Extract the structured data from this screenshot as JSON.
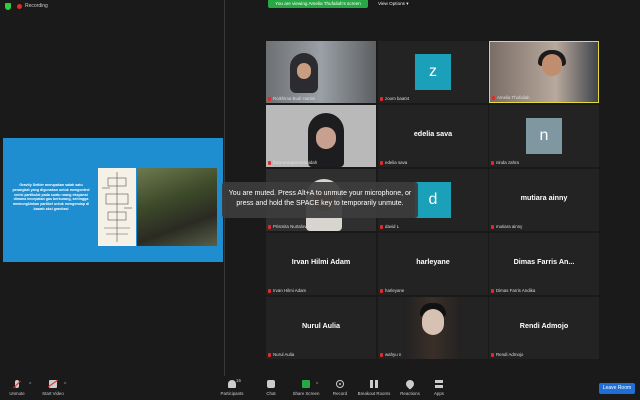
{
  "topbar": {
    "recording_label": "Recording",
    "viewing_banner": "You are viewing Amelia Thufailah's screen",
    "view_options_label": "View Options ▾"
  },
  "slide": {
    "body_text": "Gravity Settler merupakan salah satu perangkat yang digunakan untuk mengontrol emisi partikulat pada suatu ruang ekspansi dimana kecepatan gas berkurang, sehingga memungkinkan partikel untuk mengendap di bawah aksi gravitasi"
  },
  "gallery": {
    "tiles": [
      {
        "name": "Roikhima Budi Hartini",
        "display": ""
      },
      {
        "name": "zoom baa04",
        "display": "z",
        "avatar_color": "#1aa0b8"
      },
      {
        "name": "Amelia Thufailah",
        "display": ""
      },
      {
        "name": "fazurunnajmussaqidah",
        "display": ""
      },
      {
        "name": "edelia sava",
        "display": "edelia sava"
      },
      {
        "name": "ninda zahra",
        "display": "n",
        "avatar_color": "#7f97a1"
      },
      {
        "name": "Prismita Nurtalovesti",
        "display": ""
      },
      {
        "name": "david L",
        "display": "d",
        "avatar_color": "#1aa0b8"
      },
      {
        "name": "mutiara ainny",
        "display": "mutiara ainny"
      },
      {
        "name": "Irvan Hilmi Adam",
        "display": "Irvan Hilmi Adam"
      },
      {
        "name": "harleyane",
        "display": "harleyane"
      },
      {
        "name": "Dimas Farris Andika",
        "display": "Dimas Farris An..."
      },
      {
        "name": "Nurul Aulia",
        "display": "Nurul Aulia"
      },
      {
        "name": "wahyu n",
        "display": ""
      },
      {
        "name": "Rendi Admojo",
        "display": "Rendi Admojo"
      }
    ]
  },
  "toast": {
    "message": "You are muted. Press Alt+A to unmute your microphone, or press and hold the SPACE key to temporarily unmute."
  },
  "toolbar": {
    "unmute": "Unmute",
    "start_video": "Start Video",
    "participants": "Participants",
    "participant_count": "15",
    "chat": "Chat",
    "share_screen": "Share Screen",
    "record": "Record",
    "breakout_rooms": "Breakout Rooms",
    "reactions": "Reactions",
    "apps": "Apps",
    "leave": "Leave Room"
  },
  "colors": {
    "accent_green": "#27a844",
    "leave_blue": "#1f6fd6",
    "muted_red": "#e02b2b",
    "active_speaker": "#e6d93a",
    "slide_blue": "#1e8ed0"
  }
}
